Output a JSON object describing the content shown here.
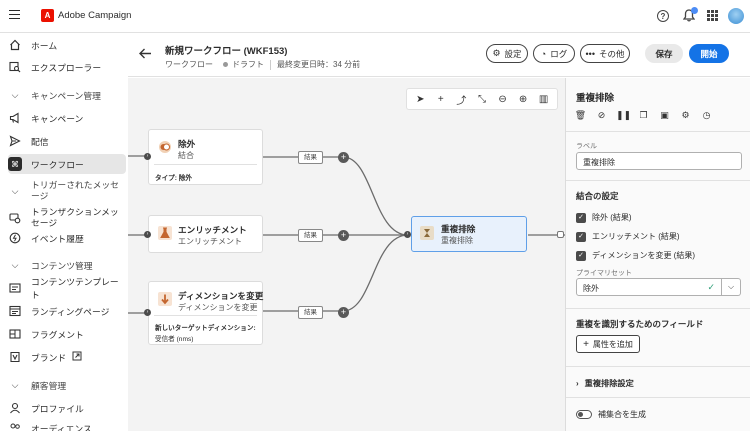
{
  "app": {
    "title": "Adobe Campaign",
    "logo_letter": "A"
  },
  "sidebar": {
    "items": [
      {
        "label": "ホーム",
        "icon": "home-icon"
      },
      {
        "label": "エクスプローラー",
        "icon": "explorer-icon"
      },
      {
        "label": "キャンペーン管理",
        "icon": "chevron-down-icon",
        "section": true
      },
      {
        "label": "キャンペーン",
        "icon": "campaign-icon"
      },
      {
        "label": "配信",
        "icon": "send-icon"
      },
      {
        "label": "ワークフロー",
        "icon": "workflow-icon",
        "selected": true
      },
      {
        "label": "トリガーされたメッセージ",
        "icon": "chevron-down-icon",
        "section": true
      },
      {
        "label": "トランザクションメッセージ",
        "icon": "transaction-icon"
      },
      {
        "label": "イベント履歴",
        "icon": "event-history-icon"
      },
      {
        "label": "コンテンツ管理",
        "icon": "chevron-down-icon",
        "section": true
      },
      {
        "label": "コンテンツテンプレート",
        "icon": "content-template-icon"
      },
      {
        "label": "ランディングページ",
        "icon": "landing-page-icon"
      },
      {
        "label": "フラグメント",
        "icon": "fragment-icon"
      },
      {
        "label": "ブランド",
        "icon": "brand-icon"
      },
      {
        "label": "顧客管理",
        "icon": "chevron-down-icon",
        "section": true
      },
      {
        "label": "プロファイル",
        "icon": "profile-icon"
      },
      {
        "label": "オーディエンス",
        "icon": "audience-icon"
      }
    ]
  },
  "header": {
    "title": "新規ワークフロー (WKF153)",
    "type": "ワークフロー",
    "status": "ドラフト",
    "modified": "最終変更日時：34 分前",
    "buttons": {
      "settings": "設定",
      "log": "ログ",
      "more": "その他",
      "save": "保存",
      "start": "開始"
    }
  },
  "canvas": {
    "nodes": [
      {
        "title": "除外",
        "subtitle": "結合",
        "detail_label": "タイプ: 除外",
        "icon": "exclude-icon",
        "icon_color": "#f7e3d3"
      },
      {
        "title": "エンリッチメント",
        "subtitle": "エンリッチメント",
        "icon": "enrichment-icon",
        "icon_color": "#f7e3d3"
      },
      {
        "title": "ディメンションを変更",
        "subtitle": "ディメンションを変更",
        "detail_label": "新しいターゲットディメンション:",
        "detail_value": "受信者 (nms)",
        "icon": "dimension-icon",
        "icon_color": "#f7e3d3"
      },
      {
        "title": "重複排除",
        "subtitle": "重複排除",
        "icon": "deduplication-icon",
        "icon_color": "#e8dcc7"
      }
    ],
    "transition_label": "結果"
  },
  "panel": {
    "title": "重複排除",
    "label_caption": "ラベル",
    "label_value": "重複排除",
    "join_settings": "結合の設定",
    "checkboxes": [
      "除外 (結果)",
      "エンリッチメント (結果)",
      "ディメンションを変更 (結果)"
    ],
    "primary_set_caption": "プライマリセット",
    "primary_set_value": "除外",
    "fields_heading": "重複を識別するためのフィールド",
    "add_attribute": "属性を追加",
    "dedup_settings": "重複排除設定",
    "generate_complement": "補集合を生成"
  }
}
